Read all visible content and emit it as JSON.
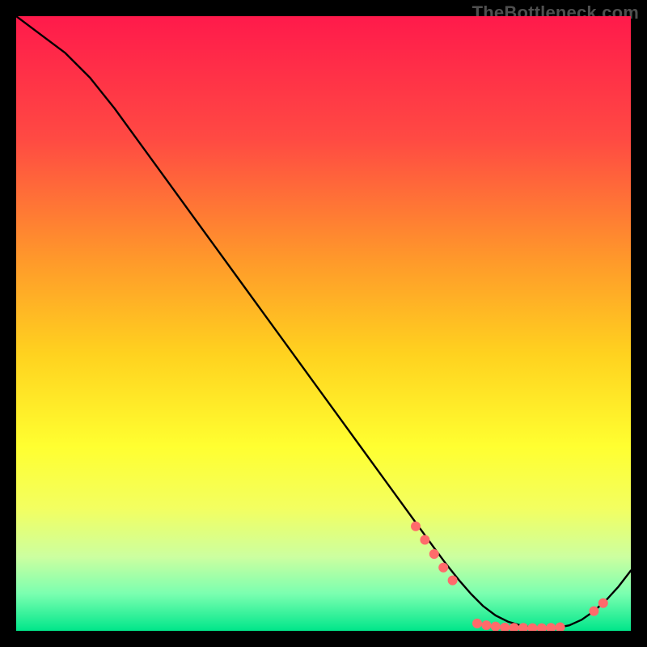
{
  "watermark": "TheBottleneck.com",
  "chart_data": {
    "type": "line",
    "title": "",
    "xlabel": "",
    "ylabel": "",
    "xlim": [
      0,
      100
    ],
    "ylim": [
      0,
      100
    ],
    "grid": false,
    "legend": false,
    "background_gradient": {
      "stops": [
        {
          "pos": 0.0,
          "color": "#ff1a4b"
        },
        {
          "pos": 0.2,
          "color": "#ff4a43"
        },
        {
          "pos": 0.4,
          "color": "#ff9a2a"
        },
        {
          "pos": 0.55,
          "color": "#ffd21f"
        },
        {
          "pos": 0.7,
          "color": "#ffff30"
        },
        {
          "pos": 0.8,
          "color": "#f3ff60"
        },
        {
          "pos": 0.88,
          "color": "#ccffa0"
        },
        {
          "pos": 0.94,
          "color": "#7affb0"
        },
        {
          "pos": 1.0,
          "color": "#00e68a"
        }
      ]
    },
    "series": [
      {
        "name": "curve",
        "color": "#000000",
        "x": [
          0,
          4,
          8,
          12,
          16,
          20,
          24,
          28,
          32,
          36,
          40,
          44,
          48,
          52,
          56,
          60,
          64,
          68,
          70,
          72,
          74,
          76,
          78,
          80,
          82,
          84,
          86,
          88,
          90,
          92,
          94,
          96,
          98,
          100
        ],
        "y": [
          100,
          97,
          94,
          90,
          85,
          79.5,
          74,
          68.5,
          63,
          57.5,
          52,
          46.5,
          41,
          35.5,
          30,
          24.5,
          19,
          13.5,
          10.8,
          8.3,
          6.0,
          4.0,
          2.5,
          1.5,
          0.9,
          0.5,
          0.4,
          0.5,
          0.9,
          1.8,
          3.2,
          5.0,
          7.2,
          9.8
        ]
      }
    ],
    "markers": {
      "name": "dots",
      "color": "#ff6b6b",
      "radius": 6,
      "points": [
        {
          "x": 65.0,
          "y": 17.0
        },
        {
          "x": 66.5,
          "y": 14.8
        },
        {
          "x": 68.0,
          "y": 12.5
        },
        {
          "x": 69.5,
          "y": 10.3
        },
        {
          "x": 71.0,
          "y": 8.2
        },
        {
          "x": 75.0,
          "y": 1.2
        },
        {
          "x": 76.5,
          "y": 0.9
        },
        {
          "x": 78.0,
          "y": 0.7
        },
        {
          "x": 79.5,
          "y": 0.55
        },
        {
          "x": 81.0,
          "y": 0.5
        },
        {
          "x": 82.5,
          "y": 0.5
        },
        {
          "x": 84.0,
          "y": 0.45
        },
        {
          "x": 85.5,
          "y": 0.45
        },
        {
          "x": 87.0,
          "y": 0.5
        },
        {
          "x": 88.5,
          "y": 0.6
        },
        {
          "x": 94.0,
          "y": 3.2
        },
        {
          "x": 95.5,
          "y": 4.5
        }
      ]
    }
  }
}
